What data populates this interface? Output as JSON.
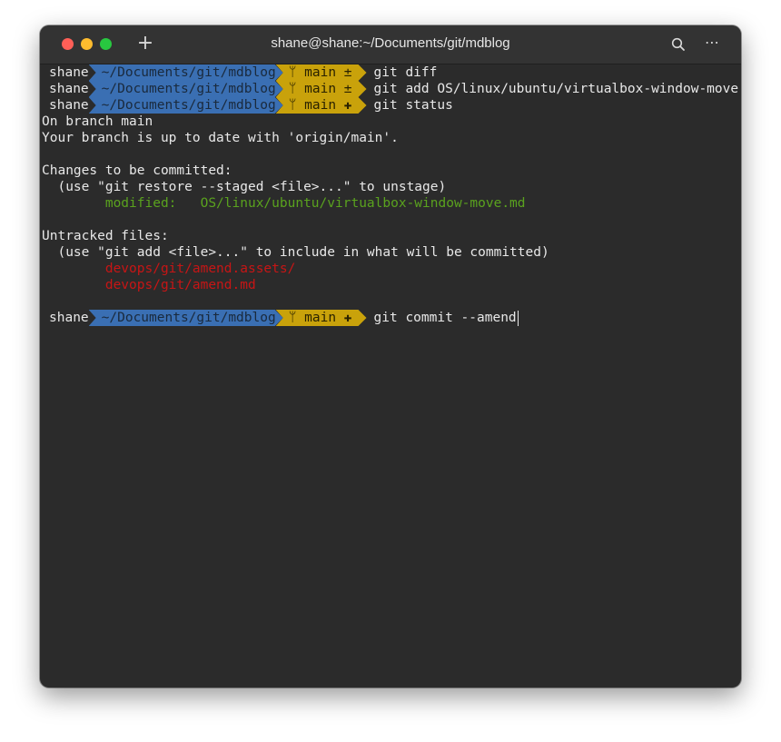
{
  "window": {
    "title": "shane@shane:~/Documents/git/mdblog",
    "new_tab_label": "+",
    "more_label": "⋯",
    "icons": [
      "close-icon",
      "minimize-icon",
      "maximize-icon",
      "plus-icon",
      "search-icon",
      "more-icon"
    ],
    "colors": {
      "close": "#ff5f57",
      "minimize": "#febc2e",
      "maximize": "#28c840",
      "path_segment": "#3a6fb3",
      "git_segment": "#c9a20b",
      "staged_text": "#5aa21e",
      "untracked_text": "#c71515"
    }
  },
  "terminal": {
    "prompts": [
      {
        "user": "shane",
        "path": "~/Documents/git/mdblog",
        "git": "ᛘ main ±",
        "command": "git diff"
      },
      {
        "user": "shane",
        "path": "~/Documents/git/mdblog",
        "git": "ᛘ main ±",
        "command": "git add OS/linux/ubuntu/virtualbox-window-move.md"
      },
      {
        "user": "shane",
        "path": "~/Documents/git/mdblog",
        "git": "ᛘ main ✚",
        "command": "git status"
      }
    ],
    "output": [
      "On branch main",
      "Your branch is up to date with 'origin/main'.",
      "",
      "Changes to be committed:",
      "  (use \"git restore --staged <file>...\" to unstage)",
      "        modified:   OS/linux/ubuntu/virtualbox-window-move.md",
      "",
      "Untracked files:",
      "  (use \"git add <file>...\" to include in what will be committed)",
      "        devops/git/amend.assets/",
      "        devops/git/amend.md",
      ""
    ],
    "current_prompt": {
      "user": "shane",
      "path": "~/Documents/git/mdblog",
      "git": "ᛘ main ✚",
      "command": "git commit --amend"
    }
  }
}
